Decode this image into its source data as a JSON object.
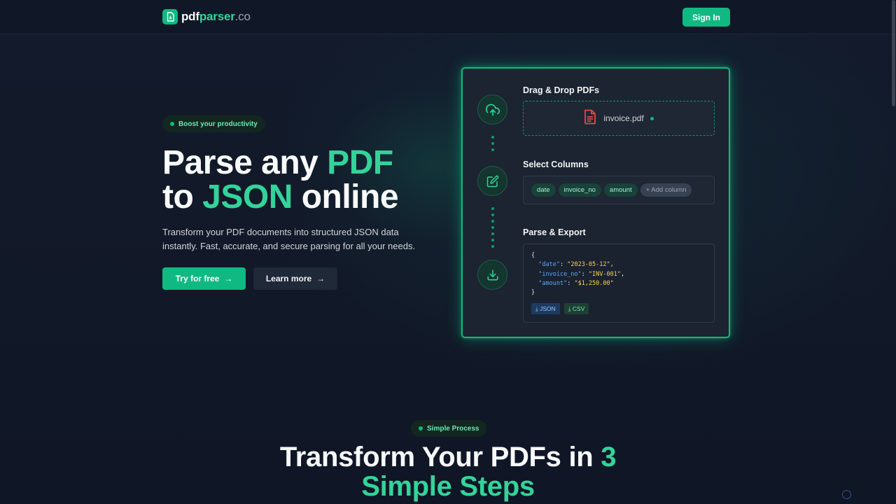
{
  "header": {
    "logo_pdf": "pdf",
    "logo_parser": "parser",
    "logo_co": ".co",
    "signin_label": "Sign In"
  },
  "hero": {
    "badge": "Boost your productivity",
    "title_part1": "Parse any ",
    "title_accent1": "PDF",
    "title_part2": "to ",
    "title_accent2": "JSON",
    "title_part3": " online",
    "description": "Transform your PDF documents into structured JSON data instantly. Fast, accurate, and secure parsing for all your needs.",
    "primary_button": "Try for free",
    "secondary_button": "Learn more"
  },
  "card": {
    "step1_title": "Drag & Drop PDFs",
    "file_name": "invoice.pdf",
    "step2_title": "Select Columns",
    "columns": [
      "date",
      "invoice_no",
      "amount"
    ],
    "add_column": "+ Add column",
    "step3_title": "Parse & Export",
    "json_lines": [
      {
        "key": "\"date\"",
        "value": "\"2023-05-12\""
      },
      {
        "key": "\"invoice_no\"",
        "value": "\"INV-001\""
      },
      {
        "key": "\"amount\"",
        "value": "\"$1,250.00\""
      }
    ],
    "export_json": "⤓ JSON",
    "export_csv": "⤓ CSV"
  },
  "section2": {
    "badge": "Simple Process",
    "title_part1": "Transform Your PDFs in ",
    "title_accent1": "3",
    "title_accent2": "Simple Steps"
  },
  "colors": {
    "accent": "#10b981",
    "accent_light": "#34d399",
    "background": "#111827",
    "file_icon": "#ef4444"
  },
  "icons": [
    "file-pdf-icon",
    "upload-cloud-icon",
    "edit-icon",
    "download-icon",
    "document-icon",
    "arrow-right-icon"
  ]
}
